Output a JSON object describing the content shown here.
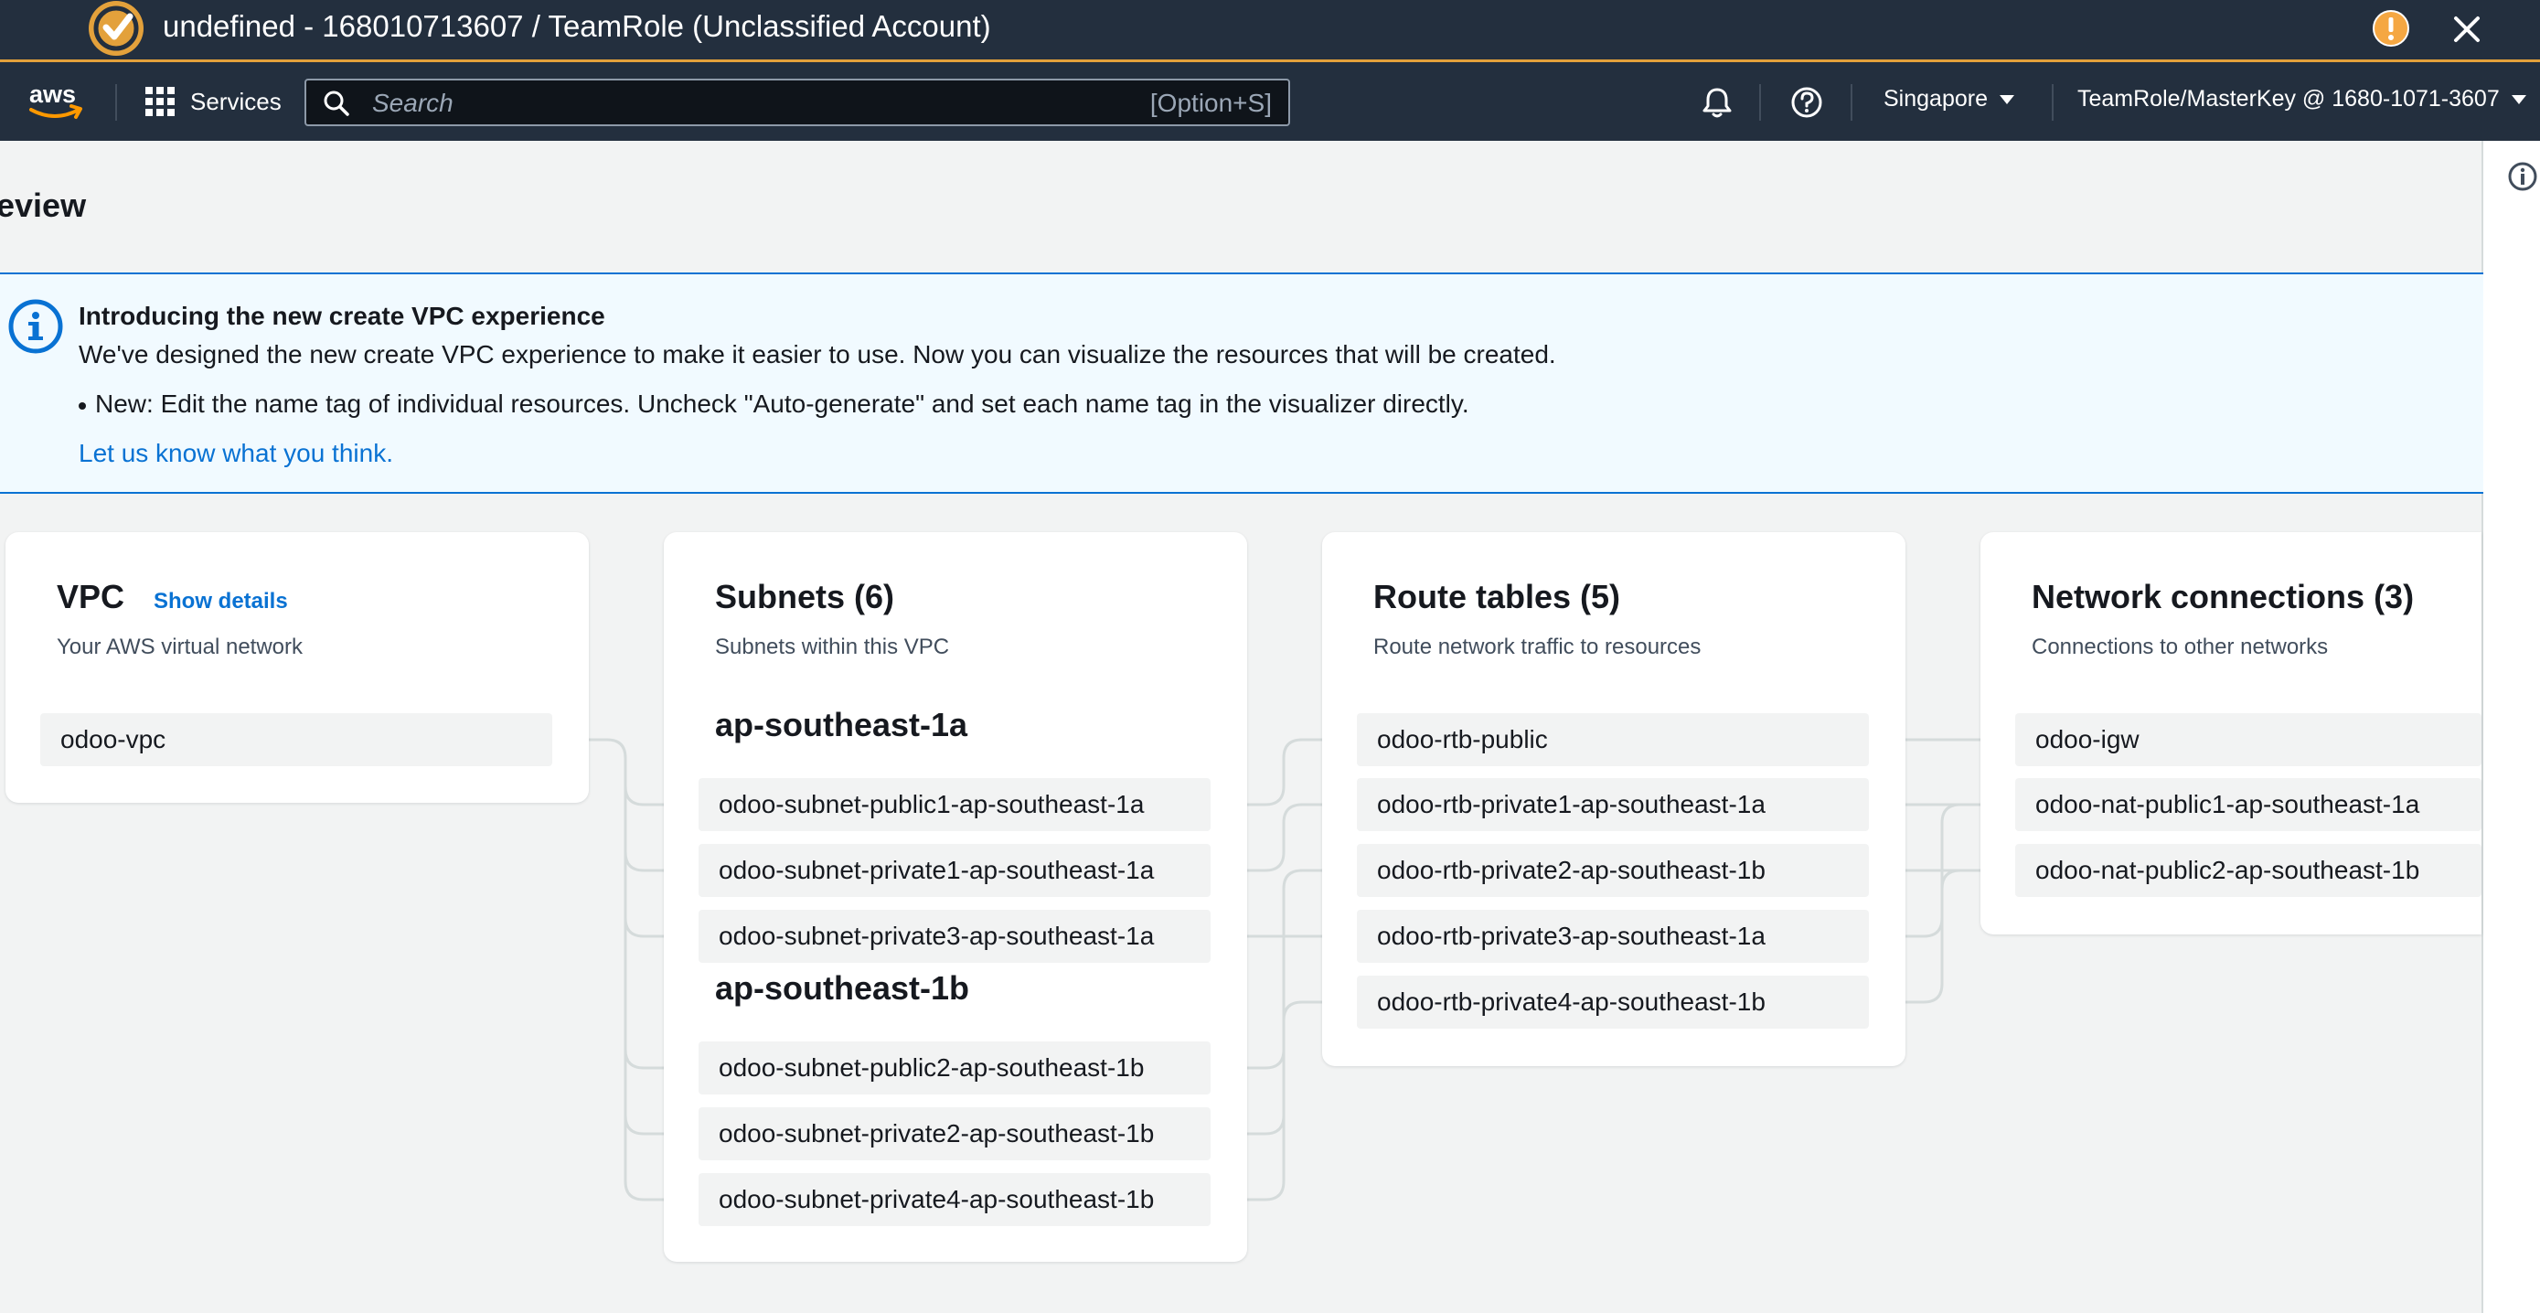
{
  "window": {
    "title": "undefined - 168010713607 / TeamRole (Unclassified Account)",
    "accent_color": "#e3a13b",
    "icons": [
      "logo-icon",
      "warning-icon",
      "close-icon"
    ]
  },
  "nav": {
    "logo_text": "aws",
    "services_label": "Services",
    "search_placeholder": "Search",
    "search_shortcut": "[Option+S]",
    "region": "Singapore",
    "account": "TeamRole/MasterKey @ 1680-1071-3607",
    "icons": [
      "grid-icon",
      "search-icon",
      "bell-icon",
      "help-icon",
      "caret-down-icon"
    ]
  },
  "page": {
    "title_partial": "eview"
  },
  "banner": {
    "heading": "Introducing the new create VPC experience",
    "text": "We've designed the new create VPC experience to make it easier to use. Now you can visualize the resources that will be created.",
    "bullet": "New: Edit the name tag of individual resources. Uncheck \"Auto-generate\" and set each name tag in the visualizer directly.",
    "link": "Let us know what you think."
  },
  "vpc": {
    "title": "VPC",
    "show_details": "Show details",
    "subtitle": "Your AWS virtual network",
    "items": [
      "odoo-vpc"
    ]
  },
  "subnets": {
    "title": "Subnets (6)",
    "subtitle": "Subnets within this VPC",
    "groups": [
      {
        "az": "ap-southeast-1a",
        "items": [
          "odoo-subnet-public1-ap-southeast-1a",
          "odoo-subnet-private1-ap-southeast-1a",
          "odoo-subnet-private3-ap-southeast-1a"
        ]
      },
      {
        "az": "ap-southeast-1b",
        "items": [
          "odoo-subnet-public2-ap-southeast-1b",
          "odoo-subnet-private2-ap-southeast-1b",
          "odoo-subnet-private4-ap-southeast-1b"
        ]
      }
    ]
  },
  "route_tables": {
    "title": "Route tables (5)",
    "subtitle": "Route network traffic to resources",
    "items": [
      "odoo-rtb-public",
      "odoo-rtb-private1-ap-southeast-1a",
      "odoo-rtb-private2-ap-southeast-1b",
      "odoo-rtb-private3-ap-southeast-1a",
      "odoo-rtb-private4-ap-southeast-1b"
    ]
  },
  "network_connections": {
    "title": "Network connections (3)",
    "subtitle": "Connections to other networks",
    "items": [
      "odoo-igw",
      "odoo-nat-public1-ap-southeast-1a",
      "odoo-nat-public2-ap-southeast-1b"
    ]
  }
}
